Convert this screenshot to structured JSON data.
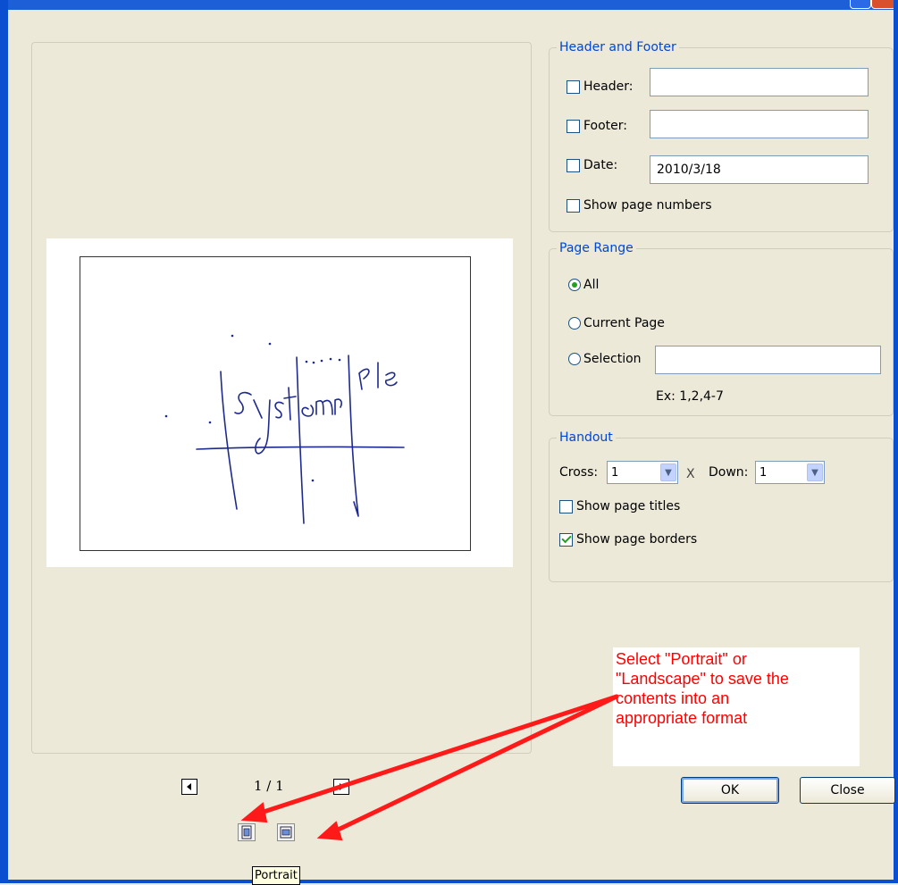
{
  "colors": {
    "accent": "#0046d5",
    "annotation": "#ff0000",
    "face": "#ece9d8"
  },
  "preview": {
    "page_indicator": "1 / 1"
  },
  "header_footer": {
    "legend": "Header and Footer",
    "header_label": "Header:",
    "header_value": "",
    "header_checked": false,
    "footer_label": "Footer:",
    "footer_value": "",
    "footer_checked": false,
    "date_label": "Date:",
    "date_value": "2010/3/18",
    "date_checked": false,
    "page_numbers_label": "Show page numbers",
    "page_numbers_checked": false
  },
  "page_range": {
    "legend": "Page Range",
    "options": [
      "All",
      "Current Page",
      "Selection"
    ],
    "selected": "All",
    "selection_value": "",
    "example": "Ex: 1,2,4-7"
  },
  "handout": {
    "legend": "Handout",
    "cross_label": "Cross:",
    "cross_value": "1",
    "x_label": "X",
    "down_label": "Down:",
    "down_value": "1",
    "show_titles_label": "Show page titles",
    "show_titles_checked": false,
    "show_borders_label": "Show page borders",
    "show_borders_checked": true
  },
  "buttons": {
    "ok": "OK",
    "close": "Close"
  },
  "orientation": {
    "tooltip": "Portrait"
  },
  "annotation": {
    "lines": [
      "Select \"Portrait\" or",
      "\"Landscape\" to save the",
      "contents into an",
      "appropriate format"
    ]
  },
  "icons": [
    "prev-page-icon",
    "next-page-icon",
    "portrait-icon",
    "landscape-icon"
  ]
}
